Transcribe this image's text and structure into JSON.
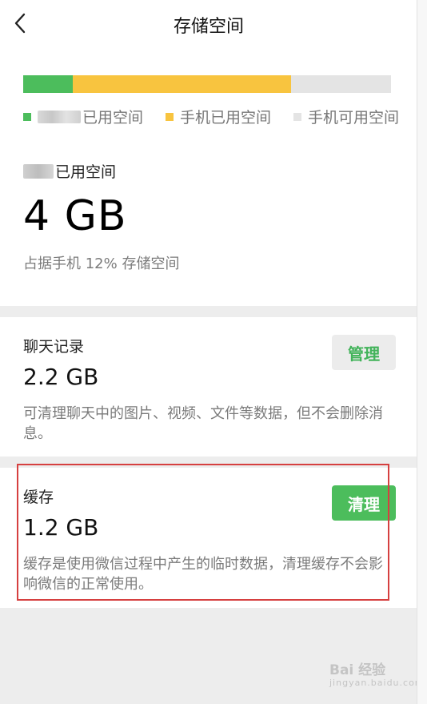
{
  "header": {
    "title": "存储空间"
  },
  "summary": {
    "bar": {
      "wechat_fraction": 0.135,
      "phone_used_fraction": 0.593
    },
    "legend": [
      {
        "label": "已用空间",
        "color": "#4cbd5c"
      },
      {
        "label": "手机已用空间",
        "color": "#f8c43f"
      },
      {
        "label": "手机可用空间",
        "color": "#e4e4e4"
      }
    ],
    "used_label": "已用空间",
    "used_value": "4 GB",
    "used_desc": "占据手机 12% 存储空间"
  },
  "chat": {
    "label": "聊天记录",
    "value": "2.2 GB",
    "desc": "可清理聊天中的图片、视频、文件等数据，但不会删除消息。",
    "button": "管理"
  },
  "cache": {
    "label": "缓存",
    "value": "1.2 GB",
    "desc": "缓存是使用微信过程中产生的临时数据，清理缓存不会影响微信的正常使用。",
    "button": "清理"
  },
  "watermark": {
    "text": "Bai 经验",
    "sub": "jingyan.baidu.com"
  }
}
